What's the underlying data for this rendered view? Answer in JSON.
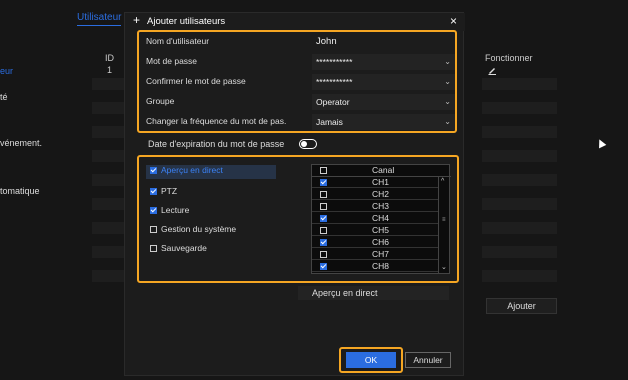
{
  "background": {
    "tab_label": "Utilisateur",
    "sidebar_items": [
      "eur",
      "té",
      "vénement.",
      "tomatique"
    ],
    "table_header_id": "ID",
    "table_row_id": "1",
    "table_header_action": "Fonctionner",
    "edit_icon": "pencil-icon",
    "add_button": "Ajouter"
  },
  "dialog": {
    "title": "Ajouter utilisateurs",
    "plus_icon": "+",
    "close_icon": "×",
    "fields": [
      {
        "label": "Nom d'utilisateur",
        "value": "John",
        "type": "text"
      },
      {
        "label": "Mot de passe",
        "value": "***********",
        "type": "password"
      },
      {
        "label": "Confirmer le mot de passe",
        "value": "***********",
        "type": "password"
      },
      {
        "label": "Groupe",
        "value": "Operator",
        "type": "select"
      },
      {
        "label": "Changer la fréquence du mot de pas.",
        "value": "Jamais",
        "type": "select"
      }
    ],
    "expiry_label": "Date d'expiration du mot de passe",
    "expiry_enabled": false,
    "permissions": [
      {
        "label": "Aperçu en direct",
        "checked": true,
        "selected": true
      },
      {
        "label": "PTZ",
        "checked": true,
        "selected": false
      },
      {
        "label": "Lecture",
        "checked": true,
        "selected": false
      },
      {
        "label": "Gestion du système",
        "checked": false,
        "selected": false
      },
      {
        "label": "Sauvegarde",
        "checked": false,
        "selected": false
      }
    ],
    "canal": {
      "header": "Canal",
      "header_checked": false,
      "rows": [
        {
          "name": "CH1",
          "checked": true
        },
        {
          "name": "CH2",
          "checked": false
        },
        {
          "name": "CH3",
          "checked": false
        },
        {
          "name": "CH4",
          "checked": true
        },
        {
          "name": "CH5",
          "checked": false
        },
        {
          "name": "CH6",
          "checked": true
        },
        {
          "name": "CH7",
          "checked": false
        },
        {
          "name": "CH8",
          "checked": true
        }
      ]
    },
    "selected_permission_label": "Aperçu en direct",
    "ok_label": "OK",
    "cancel_label": "Annuler"
  },
  "colors": {
    "accent": "#2b6de0",
    "highlight": "#f5a623"
  }
}
